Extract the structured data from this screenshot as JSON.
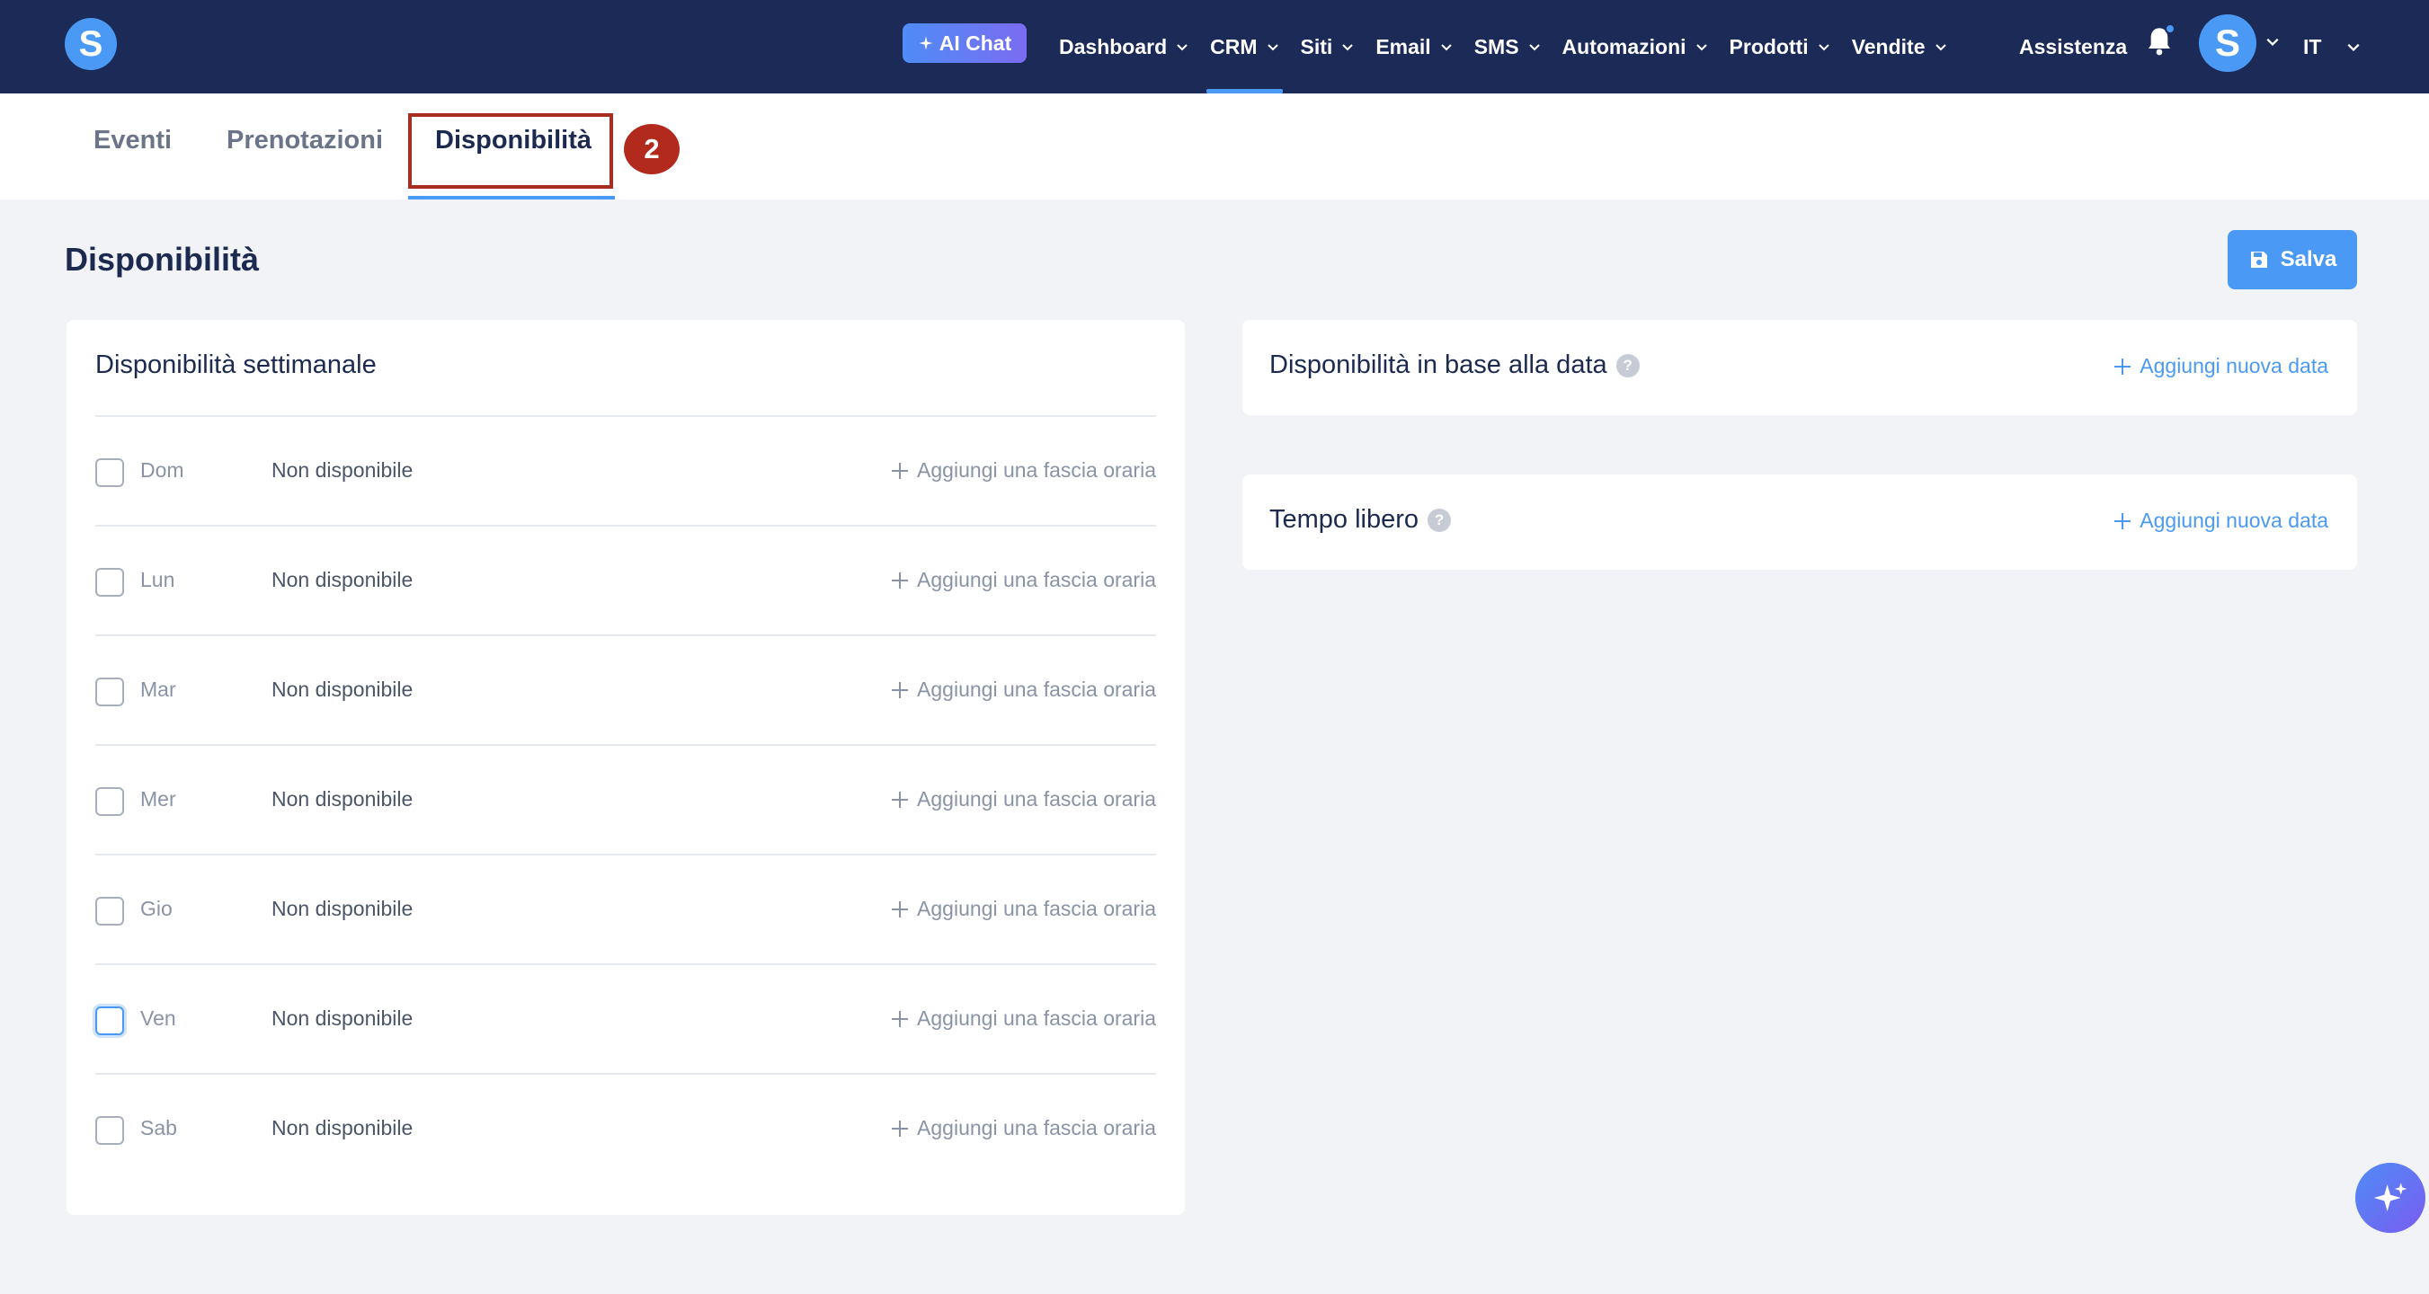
{
  "topnav": {
    "logo_letter": "S",
    "ai_chat_label": "AI Chat",
    "items": [
      {
        "label": "Dashboard"
      },
      {
        "label": "CRM"
      },
      {
        "label": "Siti"
      },
      {
        "label": "Email"
      },
      {
        "label": "SMS"
      },
      {
        "label": "Automazioni"
      },
      {
        "label": "Prodotti"
      },
      {
        "label": "Vendite"
      }
    ],
    "active_item": "CRM",
    "assistance_label": "Assistenza",
    "avatar_letter": "S",
    "language": "IT"
  },
  "subtabs": {
    "items": [
      {
        "label": "Eventi"
      },
      {
        "label": "Prenotazioni"
      },
      {
        "label": "Disponibilità"
      }
    ],
    "active": "Disponibilità",
    "step_badge": "2"
  },
  "page": {
    "title": "Disponibilità",
    "save_label": "Salva"
  },
  "weekly": {
    "title": "Disponibilità settimanale",
    "add_label": "Aggiungi una fascia oraria",
    "days": [
      {
        "name": "Dom",
        "status": "Non disponibile"
      },
      {
        "name": "Lun",
        "status": "Non disponibile"
      },
      {
        "name": "Mar",
        "status": "Non disponibile"
      },
      {
        "name": "Mer",
        "status": "Non disponibile"
      },
      {
        "name": "Gio",
        "status": "Non disponibile"
      },
      {
        "name": "Ven",
        "status": "Non disponibile"
      },
      {
        "name": "Sab",
        "status": "Non disponibile"
      }
    ]
  },
  "date_based": {
    "title": "Disponibilità in base alla data",
    "add_label": "Aggiungi nuova data"
  },
  "free_time": {
    "title": "Tempo libero",
    "add_label": "Aggiungi nuova data"
  },
  "colors": {
    "nav_bg": "#1b2a56",
    "accent": "#4a9af5",
    "highlight": "#a82d22"
  }
}
